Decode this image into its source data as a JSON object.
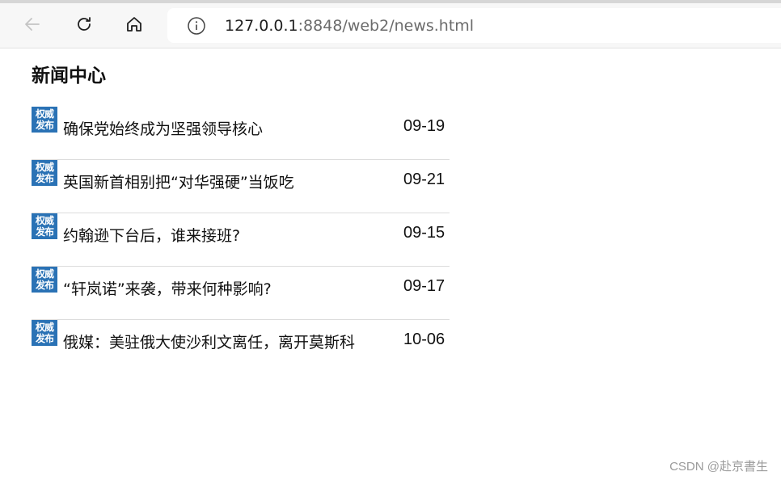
{
  "browser": {
    "url_host": "127.0.0.1",
    "url_rest": ":8848/web2/news.html"
  },
  "page": {
    "title": "新闻中心"
  },
  "badge": {
    "line1": "权威",
    "line2": "发布",
    "color": "#2a72b5"
  },
  "news": [
    {
      "title": "确保党始终成为坚强领导核心",
      "date": "09-19"
    },
    {
      "title": "英国新首相别把“对华强硬”当饭吃",
      "date": "09-21"
    },
    {
      "title": "约翰逊下台后，谁来接班?",
      "date": "09-15"
    },
    {
      "title": "“轩岚诺”来袭，带来何种影响?",
      "date": "09-17"
    },
    {
      "title": "俄媒：美驻俄大使沙利文离任，离开莫斯科",
      "date": "10-06"
    }
  ],
  "watermark": "CSDN @赴京書生"
}
